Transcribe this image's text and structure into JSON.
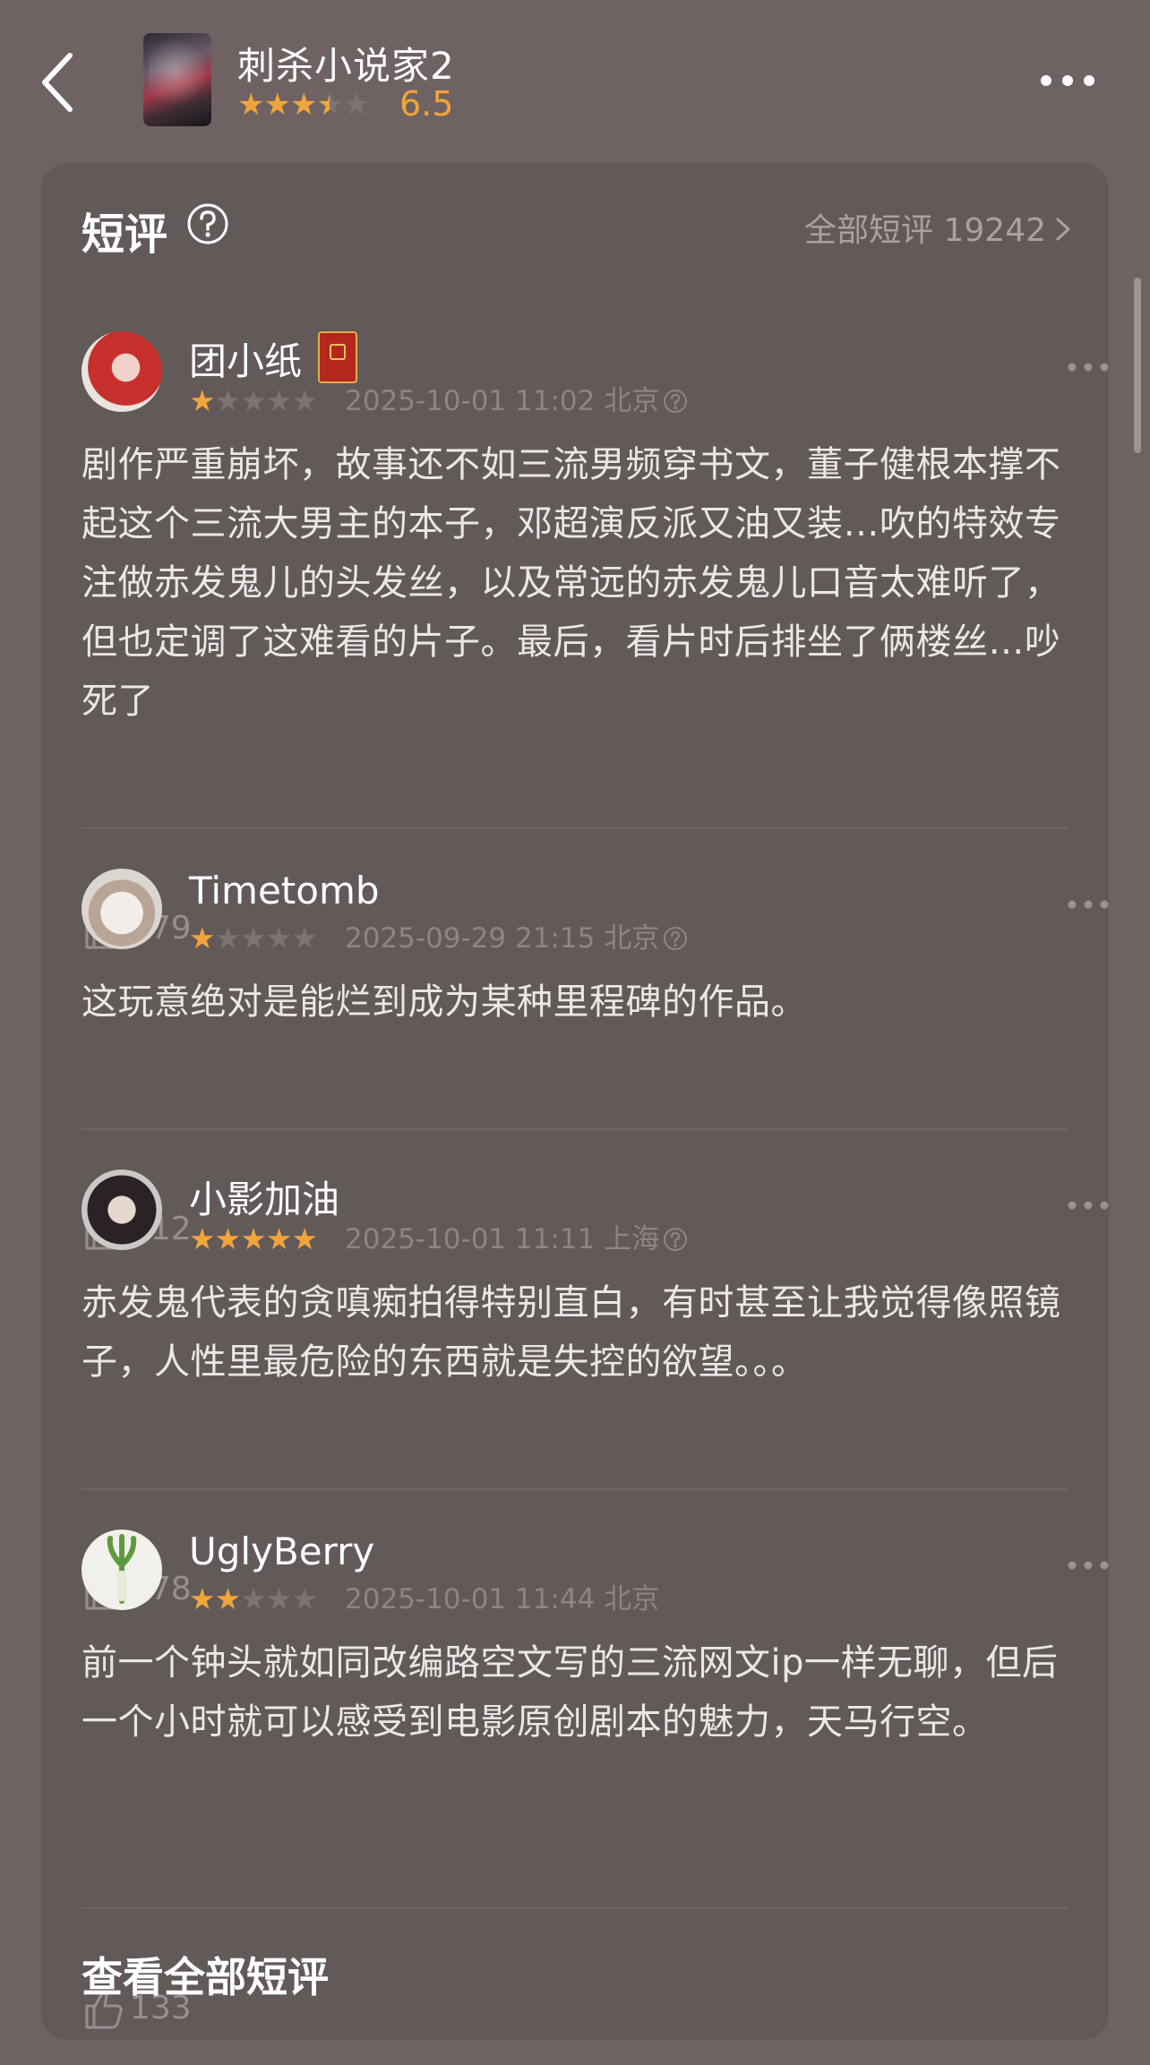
{
  "header": {
    "title": "刺杀小说家2",
    "stars": [
      "on",
      "on",
      "on",
      "half",
      "off"
    ],
    "score": "6.5"
  },
  "section": {
    "title": "短评",
    "all_link": "全部短评 19242"
  },
  "reviews": [
    {
      "user": "团小纸",
      "stars": [
        "on",
        "off",
        "off",
        "off",
        "off"
      ],
      "time": "2025-10-01 11:02",
      "location": "北京",
      "content": "剧作严重崩坏，故事还不如三流男频穿书文，董子健根本撑不起这个三流大男主的本子，邓超演反派又油又装…吹的特效专注做赤发鬼儿的头发丝，以及常远的赤发鬼儿口音太难听了，但也定调了这难看的片子。最后，看片时后排坐了俩楼丝…吵死了",
      "likes": "379"
    },
    {
      "user": "Timetomb",
      "stars": [
        "on",
        "off",
        "off",
        "off",
        "off"
      ],
      "time": "2025-09-29 21:15",
      "location": "北京",
      "content": "这玩意绝对是能烂到成为某种里程碑的作品。",
      "likes": "312"
    },
    {
      "user": "小影加油",
      "stars": [
        "on",
        "on",
        "on",
        "on",
        "on"
      ],
      "time": "2025-10-01 11:11",
      "location": "上海",
      "content": "赤发鬼代表的贪嗔痴拍得特别直白，有时甚至让我觉得像照镜子，人性里最危险的东西就是失控的欲望。。。",
      "likes": "378"
    },
    {
      "user": "UglyBerry",
      "stars": [
        "on",
        "on",
        "off",
        "off",
        "off"
      ],
      "time": "2025-10-01 11:44",
      "location": "北京",
      "content": "前一个钟头就如同改编路空文写的三流网文ip一样无聊，但后一个小时就可以感受到电影原创剧本的魅力，天马行空。",
      "likes": "133"
    }
  ],
  "footer": {
    "view_all": "查看全部短评"
  },
  "colors": {
    "background": "#6e6362",
    "card": "#625959",
    "star_on": "#f1a43b",
    "star_off": "#7c7473",
    "muted_text": "#8d8584"
  },
  "icons": {
    "back": "chevron-left-icon",
    "more": "more-horizontal-icon",
    "help": "question-circle-icon",
    "like": "thumbs-up-icon",
    "chevron": "chevron-right-icon"
  }
}
